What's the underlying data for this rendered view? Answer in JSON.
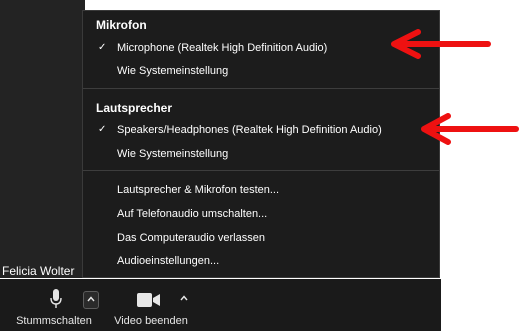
{
  "participant": {
    "name": "Felicia Wolter"
  },
  "menu": {
    "microphone_section": {
      "title": "Mikrofon",
      "items": [
        {
          "label": "Microphone (Realtek High Definition Audio)",
          "checked": true
        },
        {
          "label": "Wie Systemeinstellung",
          "checked": false
        }
      ]
    },
    "speaker_section": {
      "title": "Lautsprecher",
      "items": [
        {
          "label": "Speakers/Headphones (Realtek High Definition Audio)",
          "checked": true
        },
        {
          "label": "Wie Systemeinstellung",
          "checked": false
        }
      ]
    },
    "actions": [
      {
        "label": "Lautsprecher & Mikrofon testen..."
      },
      {
        "label": "Auf Telefonaudio umschalten..."
      },
      {
        "label": "Das Computeraudio verlassen"
      },
      {
        "label": "Audioeinstellungen..."
      }
    ],
    "check_glyph": "✓"
  },
  "toolbar": {
    "mute_label": "Stummschalten",
    "video_label": "Video beenden"
  },
  "icons": {
    "mic": "microphone-icon",
    "camera": "video-camera-icon",
    "caret": "chevron-up-icon",
    "annotation": "red-arrow-icon"
  },
  "colors": {
    "menu_bg": "#1c1c1c",
    "toolbar_bg": "#1a1a1a",
    "annotation_arrow": "#ee1111"
  }
}
